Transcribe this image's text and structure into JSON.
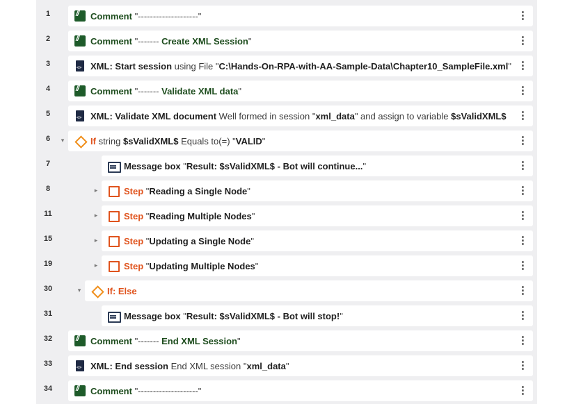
{
  "colors": {
    "panel": "#efeff1",
    "card": "#ffffff",
    "comment_green": "#1e5b2a",
    "step_orange": "#e0541e",
    "if_orange": "#f0901e"
  },
  "rows": [
    {
      "line": "1",
      "icon": "comment-icon",
      "parts": [
        [
          "kw-green",
          "Comment"
        ],
        [
          "txt",
          " \"--------------------\""
        ]
      ]
    },
    {
      "line": "2",
      "icon": "comment-icon",
      "parts": [
        [
          "kw-green",
          "Comment"
        ],
        [
          "txt",
          " \"------- "
        ],
        [
          "kw-green",
          "Create XML Session"
        ],
        [
          "txt",
          "\""
        ]
      ]
    },
    {
      "line": "3",
      "icon": "xml-file-icon",
      "parts": [
        [
          "kw",
          "XML: Start session"
        ],
        [
          "txt",
          " using File \""
        ],
        [
          "val",
          "C:\\Hands-On-RPA-with-AA-Sample-Data\\Chapter10_SampleFile.xml"
        ],
        [
          "txt",
          "\""
        ]
      ]
    },
    {
      "line": "4",
      "icon": "comment-icon",
      "parts": [
        [
          "kw-green",
          "Comment"
        ],
        [
          "txt",
          " \"------- "
        ],
        [
          "kw-green",
          "Validate XML data"
        ],
        [
          "txt",
          "\""
        ]
      ]
    },
    {
      "line": "5",
      "icon": "xml-file-icon",
      "parts": [
        [
          "kw",
          "XML: Validate XML document"
        ],
        [
          "txt",
          " Well formed in session \""
        ],
        [
          "val",
          "xml_data"
        ],
        [
          "txt",
          "\" and assign to variable "
        ],
        [
          "val",
          "$sValidXML$"
        ]
      ]
    },
    {
      "line": "6",
      "icon": "if-diamond-icon",
      "chevron": "▾",
      "parts": [
        [
          "kw-orange",
          "If"
        ],
        [
          "txt",
          " string "
        ],
        [
          "val",
          "$sValidXML$"
        ],
        [
          "txt",
          " Equals to(=) \""
        ],
        [
          "val",
          "VALID"
        ],
        [
          "txt",
          "\""
        ]
      ]
    },
    {
      "line": "7",
      "icon": "message-box-icon",
      "indent": 1,
      "parts": [
        [
          "kw",
          "Message box"
        ],
        [
          "txt",
          " \""
        ],
        [
          "val",
          "Result: $sValidXML$ - Bot will continue..."
        ],
        [
          "txt",
          "\""
        ]
      ]
    },
    {
      "line": "8",
      "icon": "step-icon",
      "indent": 1,
      "chevron": "▸",
      "parts": [
        [
          "kw-orange",
          "Step"
        ],
        [
          "txt",
          " \""
        ],
        [
          "val",
          "Reading a Single Node"
        ],
        [
          "txt",
          "\""
        ]
      ]
    },
    {
      "line": "11",
      "icon": "step-icon",
      "indent": 1,
      "chevron": "▸",
      "parts": [
        [
          "kw-orange",
          "Step"
        ],
        [
          "txt",
          " \""
        ],
        [
          "val",
          "Reading Multiple Nodes"
        ],
        [
          "txt",
          "\""
        ]
      ]
    },
    {
      "line": "15",
      "icon": "step-icon",
      "indent": 1,
      "chevron": "▸",
      "parts": [
        [
          "kw-orange",
          "Step"
        ],
        [
          "txt",
          " \""
        ],
        [
          "val",
          "Updating a Single Node"
        ],
        [
          "txt",
          "\""
        ]
      ]
    },
    {
      "line": "19",
      "icon": "step-icon",
      "indent": 1,
      "chevron": "▸",
      "parts": [
        [
          "kw-orange",
          "Step"
        ],
        [
          "txt",
          " \""
        ],
        [
          "val",
          "Updating Multiple Nodes"
        ],
        [
          "txt",
          "\""
        ]
      ]
    },
    {
      "line": "30",
      "icon": "if-diamond-icon",
      "indent": 0.5,
      "chevron": "▾",
      "parts": [
        [
          "kw-orange",
          "If: Else"
        ]
      ]
    },
    {
      "line": "31",
      "icon": "message-box-icon",
      "indent": 1,
      "parts": [
        [
          "kw",
          "Message box"
        ],
        [
          "txt",
          " \""
        ],
        [
          "val",
          "Result: $sValidXML$ - Bot will stop!"
        ],
        [
          "txt",
          "\""
        ]
      ]
    },
    {
      "line": "32",
      "icon": "comment-icon",
      "parts": [
        [
          "kw-green",
          "Comment"
        ],
        [
          "txt",
          " \"------- "
        ],
        [
          "kw-green",
          "End XML Session"
        ],
        [
          "txt",
          "\""
        ]
      ]
    },
    {
      "line": "33",
      "icon": "xml-file-icon",
      "parts": [
        [
          "kw",
          "XML: End session"
        ],
        [
          "txt",
          " End XML session \""
        ],
        [
          "val",
          "xml_data"
        ],
        [
          "txt",
          "\""
        ]
      ]
    },
    {
      "line": "34",
      "icon": "comment-icon",
      "parts": [
        [
          "kw-green",
          "Comment"
        ],
        [
          "txt",
          " \"--------------------\""
        ]
      ]
    }
  ]
}
